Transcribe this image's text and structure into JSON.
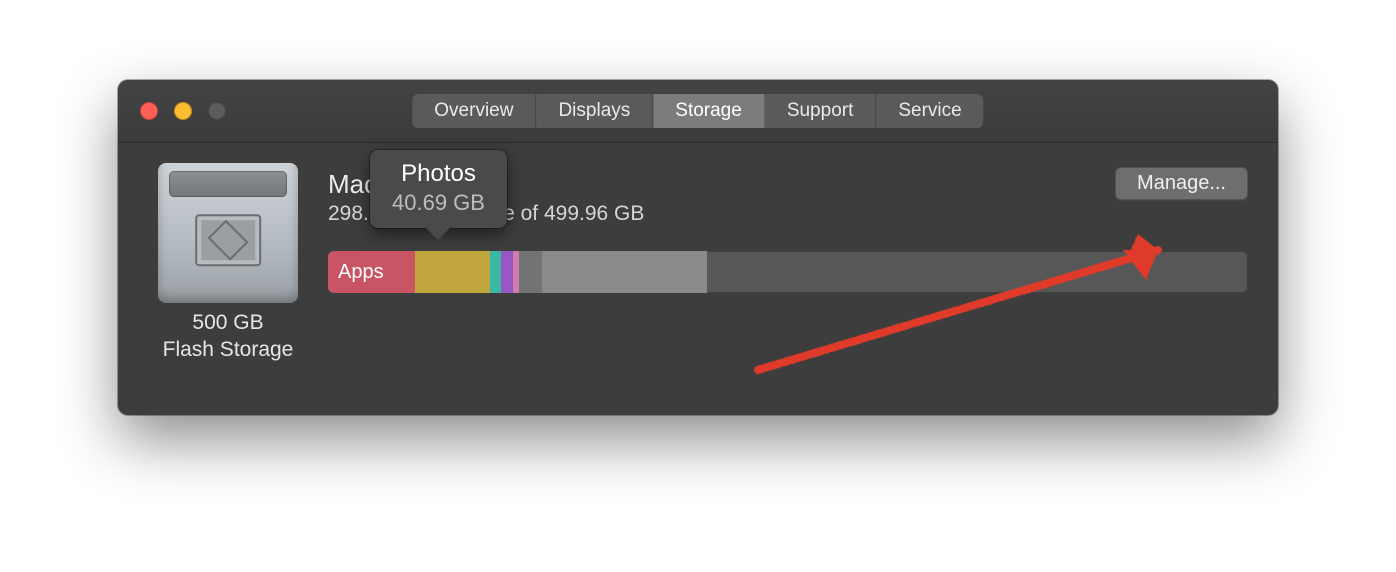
{
  "tabs": [
    {
      "label": "Overview"
    },
    {
      "label": "Displays"
    },
    {
      "label": "Storage"
    },
    {
      "label": "Support"
    },
    {
      "label": "Service"
    }
  ],
  "active_tab_index": 2,
  "drive": {
    "capacity_line1": "500 GB",
    "capacity_line2": "Flash Storage"
  },
  "volume": {
    "name_partial": "Mac",
    "availability_line_prefix": "298.",
    "availability_line_mid": "ble of",
    "availability_line_total": "499.96 GB"
  },
  "manage_button": "Manage...",
  "tooltip": {
    "title": "Photos",
    "subtitle": "40.69 GB"
  },
  "segments": {
    "apps_label": "Apps"
  },
  "colors": {
    "annotation_red": "#e03a2a"
  }
}
